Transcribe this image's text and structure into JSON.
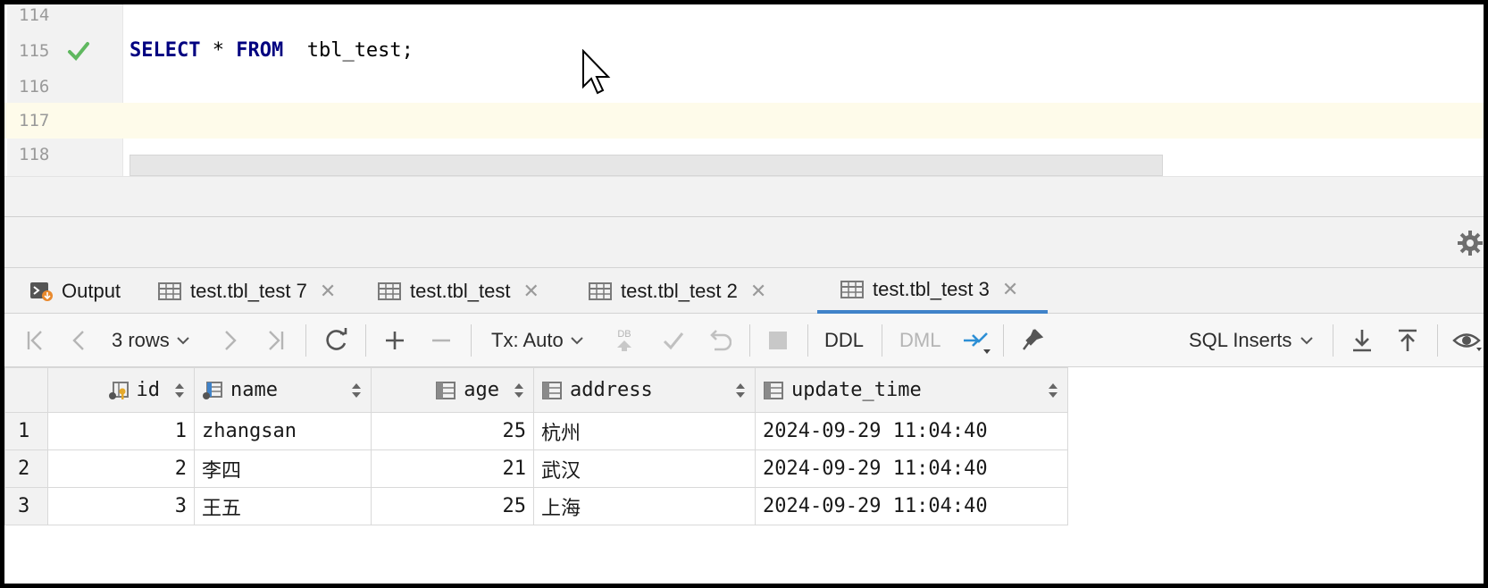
{
  "editor": {
    "lines": [
      {
        "num": "114",
        "code": ""
      },
      {
        "num": "115",
        "kw1": "SELECT",
        "mid": " * ",
        "kw2": "FROM",
        "rest": "  tbl_test;"
      },
      {
        "num": "116",
        "code": ""
      },
      {
        "num": "117",
        "code": ""
      },
      {
        "num": "118",
        "code": ""
      }
    ]
  },
  "tabs": [
    {
      "label": "Output",
      "icon": "console-icon"
    },
    {
      "label": "test.tbl_test 7",
      "icon": "table-icon"
    },
    {
      "label": "test.tbl_test",
      "icon": "table-icon"
    },
    {
      "label": "test.tbl_test 2",
      "icon": "table-icon"
    },
    {
      "label": "test.tbl_test 3",
      "icon": "table-icon",
      "active": true
    }
  ],
  "toolbar": {
    "rows_label": "3 rows",
    "tx_label": "Tx: Auto",
    "ddl_label": "DDL",
    "dml_label": "DML",
    "db_label": "DB",
    "export_format": "SQL Inserts"
  },
  "grid": {
    "columns": [
      {
        "name": "id",
        "icon": "primary-key-column-icon"
      },
      {
        "name": "name",
        "icon": "indexed-column-icon"
      },
      {
        "name": "age",
        "icon": "column-icon"
      },
      {
        "name": "address",
        "icon": "column-icon"
      },
      {
        "name": "update_time",
        "icon": "column-icon"
      }
    ],
    "rows": [
      {
        "n": "1",
        "id": "1",
        "name": "zhangsan",
        "age": "25",
        "address": "杭州",
        "update_time": "2024-09-29 11:04:40"
      },
      {
        "n": "2",
        "id": "2",
        "name": "李四",
        "age": "21",
        "address": "武汉",
        "update_time": "2024-09-29 11:04:40"
      },
      {
        "n": "3",
        "id": "3",
        "name": "王五",
        "age": "25",
        "address": "上海",
        "update_time": "2024-09-29 11:04:40"
      }
    ]
  },
  "colors": {
    "accent": "#4083c9",
    "keyword": "#000080",
    "current_line": "#fefbea",
    "check": "#5fb85f"
  }
}
